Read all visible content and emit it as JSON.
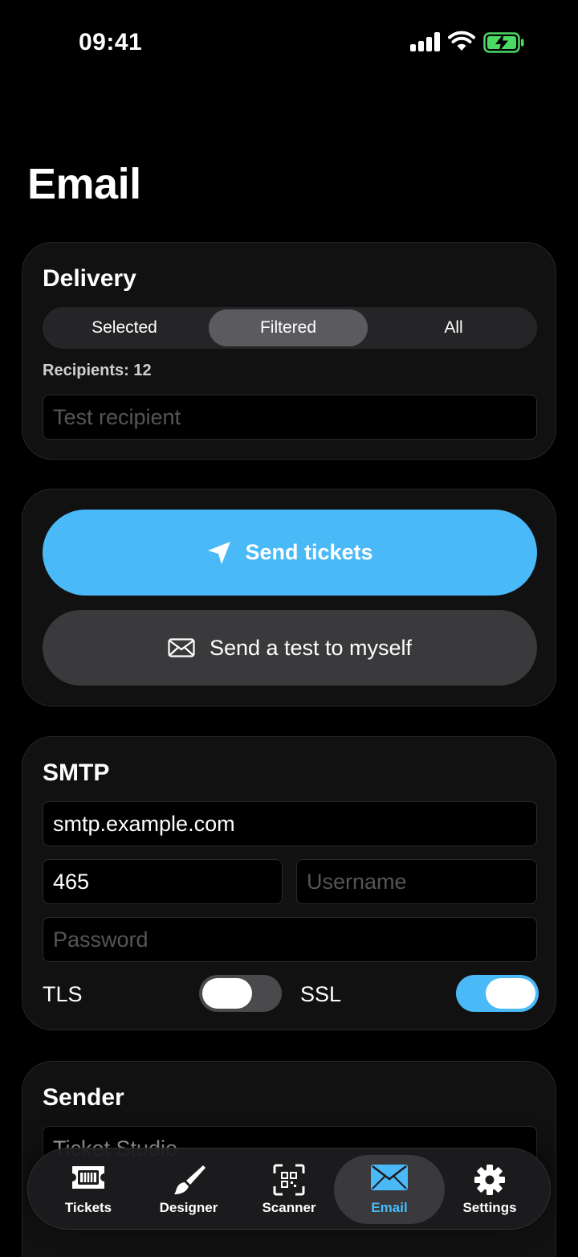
{
  "status": {
    "time": "09:41"
  },
  "page": {
    "title": "Email"
  },
  "delivery": {
    "title": "Delivery",
    "segments": [
      "Selected",
      "Filtered",
      "All"
    ],
    "selected_segment": "Filtered",
    "recipients_label": "Recipients: 12",
    "test_recipient_placeholder": "Test recipient"
  },
  "send": {
    "primary_label": "Send tickets",
    "secondary_label": "Send a test to myself"
  },
  "smtp": {
    "title": "SMTP",
    "host_value": "smtp.example.com",
    "port_value": "465",
    "username_placeholder": "Username",
    "password_placeholder": "Password",
    "tls_label": "TLS",
    "tls_on": false,
    "ssl_label": "SSL",
    "ssl_on": true
  },
  "sender": {
    "title": "Sender",
    "name_value": "Ticket Studio"
  },
  "tabs": [
    {
      "label": "Tickets",
      "icon": "ticket-icon"
    },
    {
      "label": "Designer",
      "icon": "paintbrush-icon"
    },
    {
      "label": "Scanner",
      "icon": "qr-scanner-icon"
    },
    {
      "label": "Email",
      "icon": "envelope-icon",
      "active": true
    },
    {
      "label": "Settings",
      "icon": "gear-icon"
    }
  ],
  "colors": {
    "accent": "#4ab9f7",
    "background": "#000000",
    "card": "#111111",
    "battery": "#4cd964"
  }
}
